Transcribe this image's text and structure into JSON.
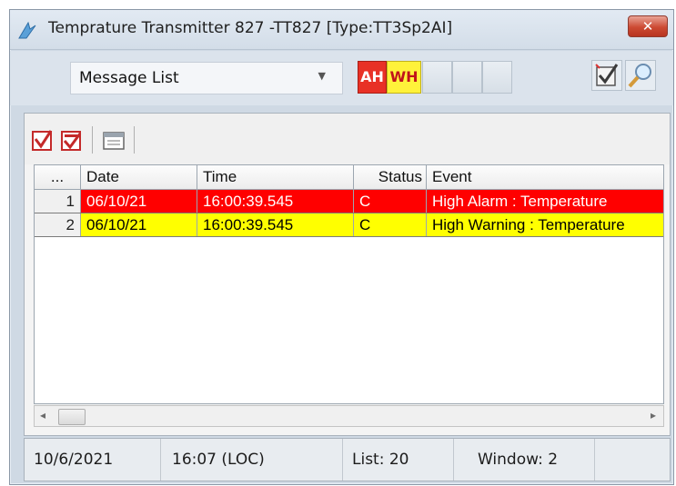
{
  "window": {
    "title": "Temprature Transmitter 827 -TT827  [Type:TT3Sp2AI]",
    "close_label": "✕"
  },
  "toolbar": {
    "view_selector": {
      "value": "Message List",
      "arrow": "▼"
    },
    "alarm_badges": [
      {
        "label": "AH",
        "color": "#e83126"
      },
      {
        "label": "WH",
        "color": "#fff23a"
      }
    ],
    "icons": [
      "acknowledge-icon",
      "search-icon"
    ]
  },
  "list_toolbar": {
    "icons": [
      "acknowledge-all-icon",
      "acknowledge-selected-icon",
      "calendar-icon"
    ]
  },
  "table": {
    "columns": [
      "...",
      "Date",
      "Time",
      "Status",
      "Event"
    ],
    "rows": [
      {
        "num": "1",
        "date": "06/10/21",
        "time": "16:00:39.545",
        "status": "C",
        "event": "High Alarm : Temperature",
        "bg": "#ff0000",
        "fg": "#ffffff"
      },
      {
        "num": "2",
        "date": "06/10/21",
        "time": "16:00:39.545",
        "status": "C",
        "event": "High Warning : Temperature",
        "bg": "#ffff00",
        "fg": "#000000"
      }
    ]
  },
  "scrollbar": {
    "left": "◂",
    "right": "▸"
  },
  "statusbar": {
    "date": "10/6/2021",
    "time": "16:07 (LOC)",
    "list": "List: 20",
    "window": "Window: 2"
  }
}
